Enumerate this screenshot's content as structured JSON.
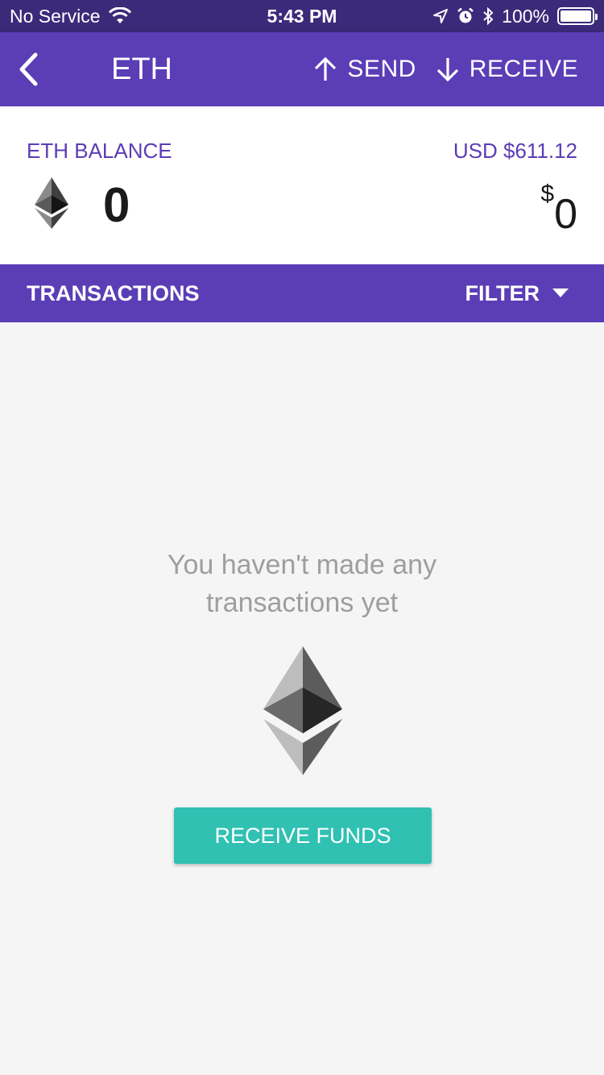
{
  "status_bar": {
    "carrier": "No Service",
    "time": "5:43 PM",
    "battery": "100%",
    "icons": [
      "wifi-icon",
      "location-icon",
      "alarm-icon",
      "bluetooth-icon",
      "battery-icon"
    ]
  },
  "app_bar": {
    "title": "ETH",
    "send_label": "SEND",
    "receive_label": "RECEIVE",
    "color": "#5b3db6"
  },
  "balance": {
    "label": "ETH BALANCE",
    "rate": "USD $611.12",
    "amount": "0",
    "fiat_symbol": "$",
    "fiat_amount": "0"
  },
  "transactions": {
    "title": "TRANSACTIONS",
    "filter_label": "FILTER"
  },
  "empty_state": {
    "line1": "You haven't made any",
    "line2": "transactions yet",
    "button_label": "RECEIVE FUNDS",
    "button_color": "#30c1b3"
  }
}
